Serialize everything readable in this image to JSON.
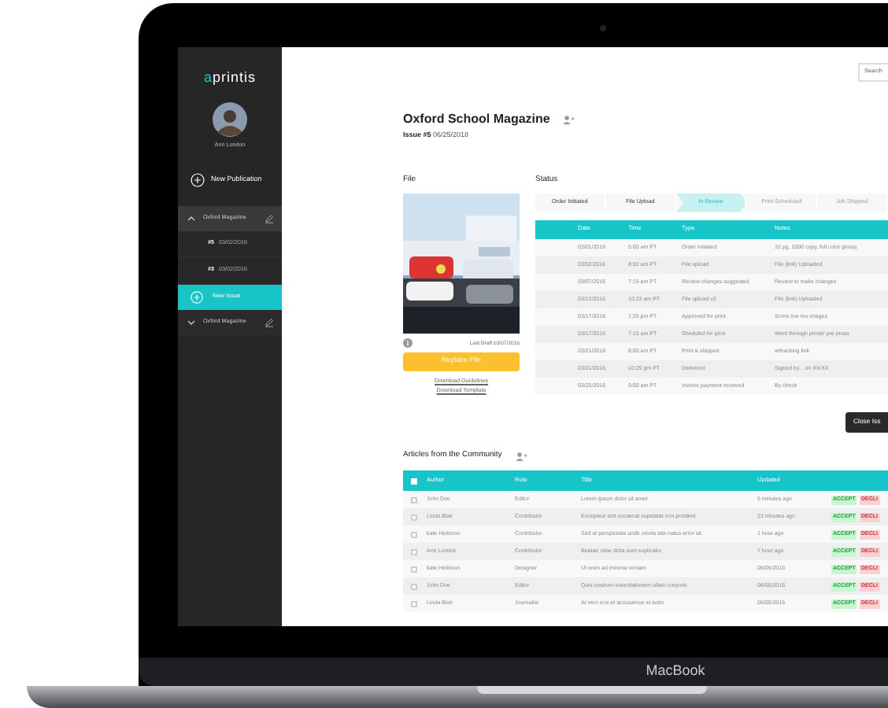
{
  "sidebar": {
    "logo": "aprintis",
    "user_name": "Ann London",
    "new_publication": "New Publication",
    "publications": [
      {
        "title": "Oxford Magazine",
        "expanded": true,
        "issues": [
          {
            "number": "#5",
            "date": "03/02/2016"
          },
          {
            "number": "#3",
            "date": "03/02/2016"
          }
        ],
        "new_issue": "New Issue"
      },
      {
        "title": "Oxford Magazine",
        "expanded": false
      }
    ]
  },
  "search": {
    "placeholder": "Search"
  },
  "publication": {
    "title": "Oxford School Magazine",
    "issue_label": "Issue #5",
    "issue_date": "06/25/2018"
  },
  "file": {
    "heading": "File",
    "last_draft": "Last Draft 03/07/2016",
    "replace_button": "Replace File",
    "links": [
      "Download Guidelines",
      "Download Template"
    ]
  },
  "status": {
    "heading": "Status",
    "steps": [
      {
        "label": "Order Initiated",
        "completed": true,
        "selected": false
      },
      {
        "label": "File Upload",
        "completed": true,
        "selected": false
      },
      {
        "label": "In Review",
        "completed": false,
        "selected": true
      },
      {
        "label": "Print Scheduled",
        "completed": false,
        "selected": false
      },
      {
        "label": "Job Shipped",
        "completed": false,
        "selected": false
      }
    ],
    "columns": [
      "Date",
      "Time",
      "Type",
      "Notes"
    ],
    "rows": [
      [
        "03/01/2016",
        "5:00 am PT",
        "Order Initiated",
        "32 pg, 1000 copy, full color glossy"
      ],
      [
        "03/02/2016",
        "8:00 am PT",
        "File upload",
        "File (link) Uploaded"
      ],
      [
        "03/07/2016",
        "7:15 am PT",
        "Review changes suggested",
        "Review to make changes"
      ],
      [
        "03/12/2016",
        "10:23 am PT",
        "File upload v2",
        "File (link) Uploaded"
      ],
      [
        "03/17/2016",
        "1:20 pm PT",
        "Approved for print",
        "Some low res images"
      ],
      [
        "03/17/2016",
        "7:15 am PT",
        "Sheduled for print",
        "Went through printer pre press"
      ],
      [
        "03/21/2016",
        "8:00 am PT",
        "Print & shipped",
        "w/tracking link"
      ],
      [
        "03/21/2016",
        "10:25 pm PT",
        "Delivered",
        "Signed by... on XX/XX"
      ],
      [
        "03/25/2016",
        "9:00 am PT",
        "Invoice payment received",
        "By check"
      ]
    ]
  },
  "close_button": "Close Iss",
  "articles": {
    "heading": "Articles from the Community",
    "columns": [
      "Author",
      "Role",
      "Title",
      "Updated"
    ],
    "all_checked": false,
    "rows": [
      {
        "checked": false,
        "cells": [
          "John Doe",
          "Editor",
          "Lorem ipsum dolor sit amet",
          "5 minutes ago"
        ],
        "accept": "ACCEPT",
        "decline": "DECLI"
      },
      {
        "checked": false,
        "cells": [
          "Linda Blair",
          "Contributor",
          "Excepteur sint occaecat cupidatat non proident",
          "23 minutes ago"
        ],
        "accept": "ACCEPT",
        "decline": "DECLI"
      },
      {
        "checked": false,
        "cells": [
          "kate Hickinon",
          "Contributor",
          "Sed ut perspiciatis unde omnis iste natus error sit",
          "1 hour ago"
        ],
        "accept": "ACCEPT",
        "decline": "DECLI"
      },
      {
        "checked": false,
        "cells": [
          "Ann London",
          "Contributor",
          "Beatae vitae dicta sunt explicabo",
          "7 hour ago"
        ],
        "accept": "ACCEPT",
        "decline": "DECLI"
      },
      {
        "checked": false,
        "cells": [
          "kate Hickinon",
          "Designer",
          "Ut enim ad minima veniam",
          "06/05/2016"
        ],
        "accept": "ACCEPT",
        "decline": "DECLI"
      },
      {
        "checked": false,
        "cells": [
          "John Doe",
          "Editor",
          "Quis nostrum exercitationem ullam corporis",
          "06/05/2016"
        ],
        "accept": "ACCEPT",
        "decline": "DECLI"
      },
      {
        "checked": false,
        "cells": [
          "Linda Blair",
          "Journalist",
          "At vero eos et accusamus et iusto",
          "06/05/2016"
        ],
        "accept": "ACCEPT",
        "decline": "DECLI"
      }
    ]
  },
  "device_label": "MacBook"
}
